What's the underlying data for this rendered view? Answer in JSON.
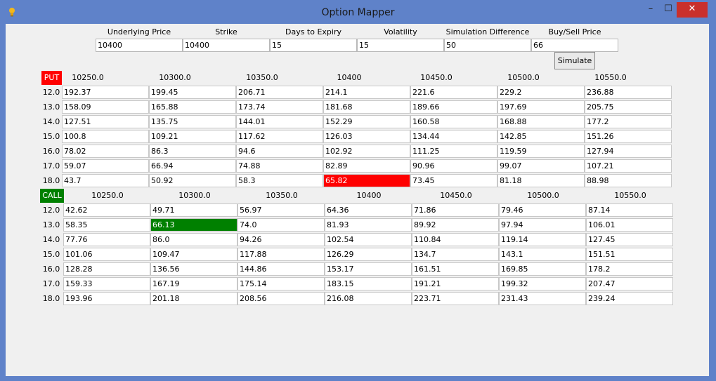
{
  "window": {
    "title": "Option Mapper",
    "app_icon": "lightbulb-icon",
    "minimize_glyph": "–",
    "maximize_glyph": "☐",
    "close_glyph": "✕",
    "close_color": "#c9302c"
  },
  "params": [
    {
      "label": "Underlying Price",
      "value": "10400"
    },
    {
      "label": "Strike",
      "value": "10400"
    },
    {
      "label": "Days to Expiry",
      "value": "15"
    },
    {
      "label": "Volatility",
      "value": "15"
    },
    {
      "label": "Simulation Difference",
      "value": "50"
    },
    {
      "label": "Buy/Sell Price",
      "value": "66"
    }
  ],
  "simulate_label": "Simulate",
  "put": {
    "badge": "PUT",
    "badge_color": "#ff0000",
    "strikes": [
      "10250.0",
      "10300.0",
      "10350.0",
      "10400",
      "10450.0",
      "10500.0",
      "10550.0"
    ],
    "rows": [
      {
        "label": "12.0",
        "values": [
          "192.37",
          "199.45",
          "206.71",
          "214.1",
          "221.6",
          "229.2",
          "236.88"
        ]
      },
      {
        "label": "13.0",
        "values": [
          "158.09",
          "165.88",
          "173.74",
          "181.68",
          "189.66",
          "197.69",
          "205.75"
        ]
      },
      {
        "label": "14.0",
        "values": [
          "127.51",
          "135.75",
          "144.01",
          "152.29",
          "160.58",
          "168.88",
          "177.2"
        ]
      },
      {
        "label": "15.0",
        "values": [
          "100.8",
          "109.21",
          "117.62",
          "126.03",
          "134.44",
          "142.85",
          "151.26"
        ]
      },
      {
        "label": "16.0",
        "values": [
          "78.02",
          "86.3",
          "94.6",
          "102.92",
          "111.25",
          "119.59",
          "127.94"
        ]
      },
      {
        "label": "17.0",
        "values": [
          "59.07",
          "66.94",
          "74.88",
          "82.89",
          "90.96",
          "99.07",
          "107.21"
        ]
      },
      {
        "label": "18.0",
        "values": [
          "43.7",
          "50.92",
          "58.3",
          "65.82",
          "73.45",
          "81.18",
          "88.98"
        ]
      }
    ],
    "highlight": {
      "row": 6,
      "col": 3,
      "color": "#ff0000"
    }
  },
  "call": {
    "badge": "CALL",
    "badge_color": "#008000",
    "strikes": [
      "10250.0",
      "10300.0",
      "10350.0",
      "10400",
      "10450.0",
      "10500.0",
      "10550.0"
    ],
    "rows": [
      {
        "label": "12.0",
        "values": [
          "42.62",
          "49.71",
          "56.97",
          "64.36",
          "71.86",
          "79.46",
          "87.14"
        ]
      },
      {
        "label": "13.0",
        "values": [
          "58.35",
          "66.13",
          "74.0",
          "81.93",
          "89.92",
          "97.94",
          "106.01"
        ]
      },
      {
        "label": "14.0",
        "values": [
          "77.76",
          "86.0",
          "94.26",
          "102.54",
          "110.84",
          "119.14",
          "127.45"
        ]
      },
      {
        "label": "15.0",
        "values": [
          "101.06",
          "109.47",
          "117.88",
          "126.29",
          "134.7",
          "143.1",
          "151.51"
        ]
      },
      {
        "label": "16.0",
        "values": [
          "128.28",
          "136.56",
          "144.86",
          "153.17",
          "161.51",
          "169.85",
          "178.2"
        ]
      },
      {
        "label": "17.0",
        "values": [
          "159.33",
          "167.19",
          "175.14",
          "183.15",
          "191.21",
          "199.32",
          "207.47"
        ]
      },
      {
        "label": "18.0",
        "values": [
          "193.96",
          "201.18",
          "208.56",
          "216.08",
          "223.71",
          "231.43",
          "239.24"
        ]
      }
    ],
    "highlight": {
      "row": 1,
      "col": 1,
      "color": "#008000"
    }
  }
}
